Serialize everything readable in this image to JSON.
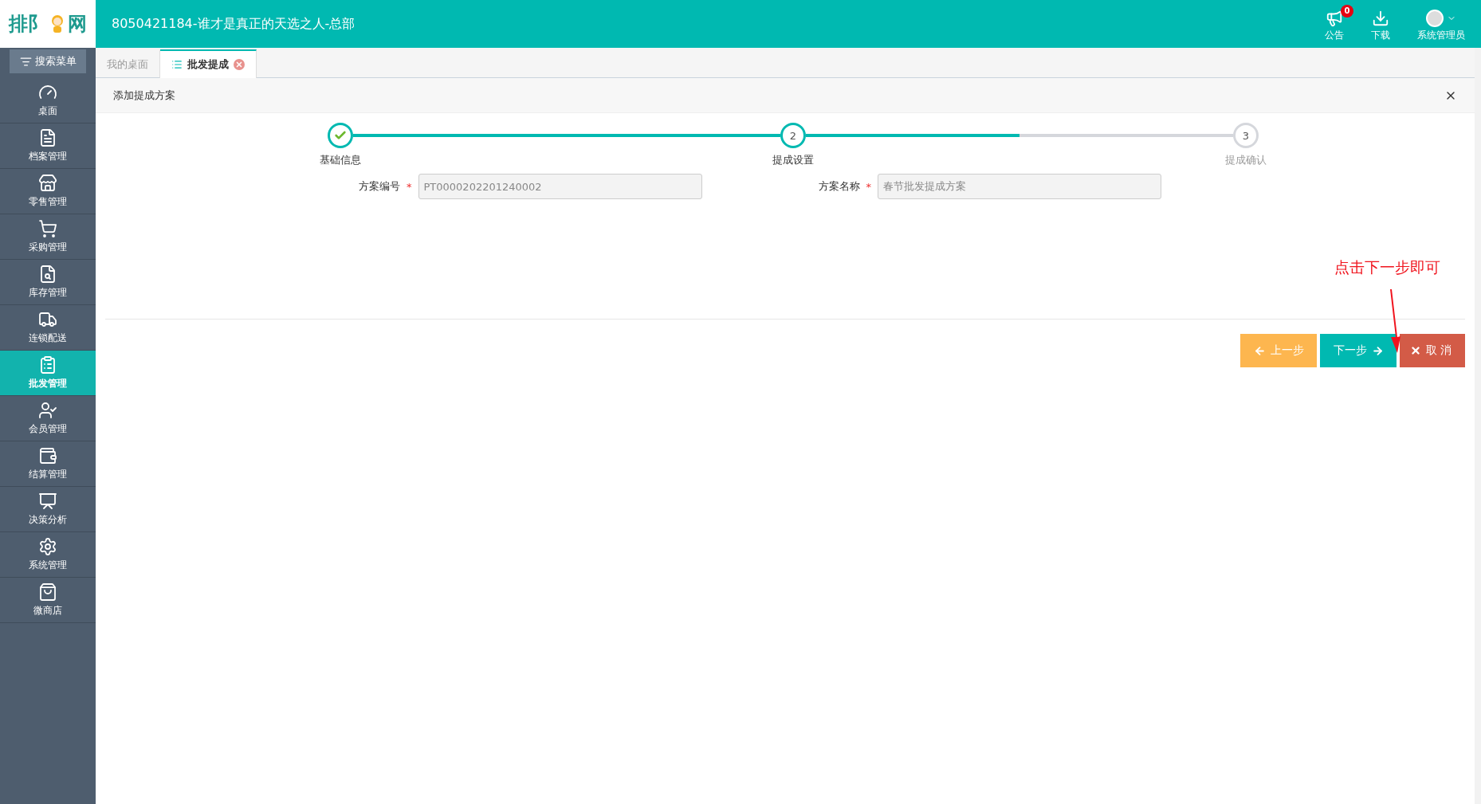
{
  "app": {
    "logo_left": "排阝",
    "logo_right": "网",
    "title": "8050421184-谁才是真正的天选之人-总部"
  },
  "header_actions": [
    {
      "kind": "notice",
      "label": "公告",
      "badge": "0"
    },
    {
      "kind": "download",
      "label": "下载"
    },
    {
      "kind": "user",
      "label": "系统管理员"
    }
  ],
  "sidebar": {
    "search": "搜索菜单",
    "items": [
      {
        "label": "桌面",
        "selected": false
      },
      {
        "label": "档案管理",
        "selected": false
      },
      {
        "label": "零售管理",
        "selected": false
      },
      {
        "label": "采购管理",
        "selected": false
      },
      {
        "label": "库存管理",
        "selected": false
      },
      {
        "label": "连锁配送",
        "selected": false
      },
      {
        "label": "批发管理",
        "selected": true
      },
      {
        "label": "会员管理",
        "selected": false
      },
      {
        "label": "结算管理",
        "selected": false
      },
      {
        "label": "决策分析",
        "selected": false
      },
      {
        "label": "系统管理",
        "selected": false
      },
      {
        "label": "微商店",
        "selected": false
      }
    ]
  },
  "tabs": [
    {
      "label": "我的桌面",
      "selected": false,
      "closable": false
    },
    {
      "label": "批发提成",
      "selected": true,
      "closable": true
    }
  ],
  "panel": {
    "title": "添加提成方案",
    "connectors": [
      {
        "level": 1
      },
      {
        "level": 0.5
      }
    ],
    "steps": [
      {
        "label": "基础信息",
        "completed": true,
        "active": false
      },
      {
        "number": "2",
        "label": "提成设置",
        "completed": false,
        "active": true
      },
      {
        "number": "3",
        "label": "提成确认",
        "completed": false,
        "active": false
      }
    ],
    "fields": [
      {
        "label": "方案编号",
        "marker": "*",
        "value": "PT0000202201240002"
      },
      {
        "label": "方案名称",
        "marker": "*",
        "value": "春节批发提成方案"
      }
    ],
    "annotation": "点击下一步即可",
    "buttons": [
      {
        "kind": "prev",
        "label": "上一步"
      },
      {
        "kind": "next",
        "label": "下一步"
      },
      {
        "kind": "cancel",
        "label": "取消"
      }
    ]
  }
}
